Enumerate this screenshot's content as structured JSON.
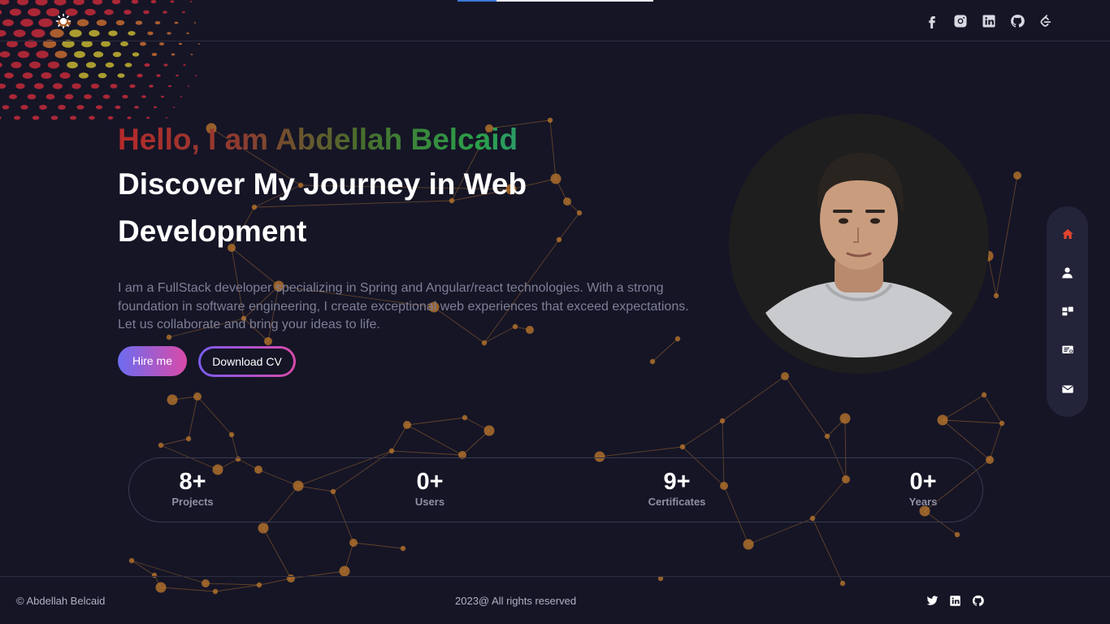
{
  "colors": {
    "background": "#151526",
    "node": "#c07a2c",
    "nav_active": "#e0452f",
    "intro_text": "#7d7f96"
  },
  "header": {
    "theme_toggle_icon": "sun-icon",
    "scroll_progress": 0.2,
    "social_icons": [
      "facebook-icon",
      "instagram-icon",
      "linkedin-icon",
      "github-icon",
      "leetcode-icon"
    ]
  },
  "hero": {
    "greeting": "Hello, I am Abdellah Belcaid",
    "headline": "Discover My Journey in Web Development",
    "intro": "I am a FullStack developer specializing in Spring and Angular/react technologies. With a strong foundation in software engineering, I create exceptional web experiences that exceed expectations. Let us collaborate and bring your ideas to life.",
    "hire_label": "Hire me",
    "cv_label": "Download CV"
  },
  "side_nav": {
    "items": [
      {
        "icon": "home-icon",
        "active": true
      },
      {
        "icon": "user-icon",
        "active": false
      },
      {
        "icon": "projects-icon",
        "active": false
      },
      {
        "icon": "certificate-icon",
        "active": false
      },
      {
        "icon": "mail-icon",
        "active": false
      }
    ]
  },
  "stats": [
    {
      "value": "8+",
      "label": "Projects"
    },
    {
      "value": "0+",
      "label": "Users"
    },
    {
      "value": "9+",
      "label": "Certificates"
    },
    {
      "value": "0+",
      "label": "Years"
    }
  ],
  "footer": {
    "copyright": "© Abdellah Belcaid",
    "rights": "2023@ All rights reserved",
    "social_icons": [
      "twitter-icon",
      "linkedin-icon",
      "github-icon"
    ]
  }
}
